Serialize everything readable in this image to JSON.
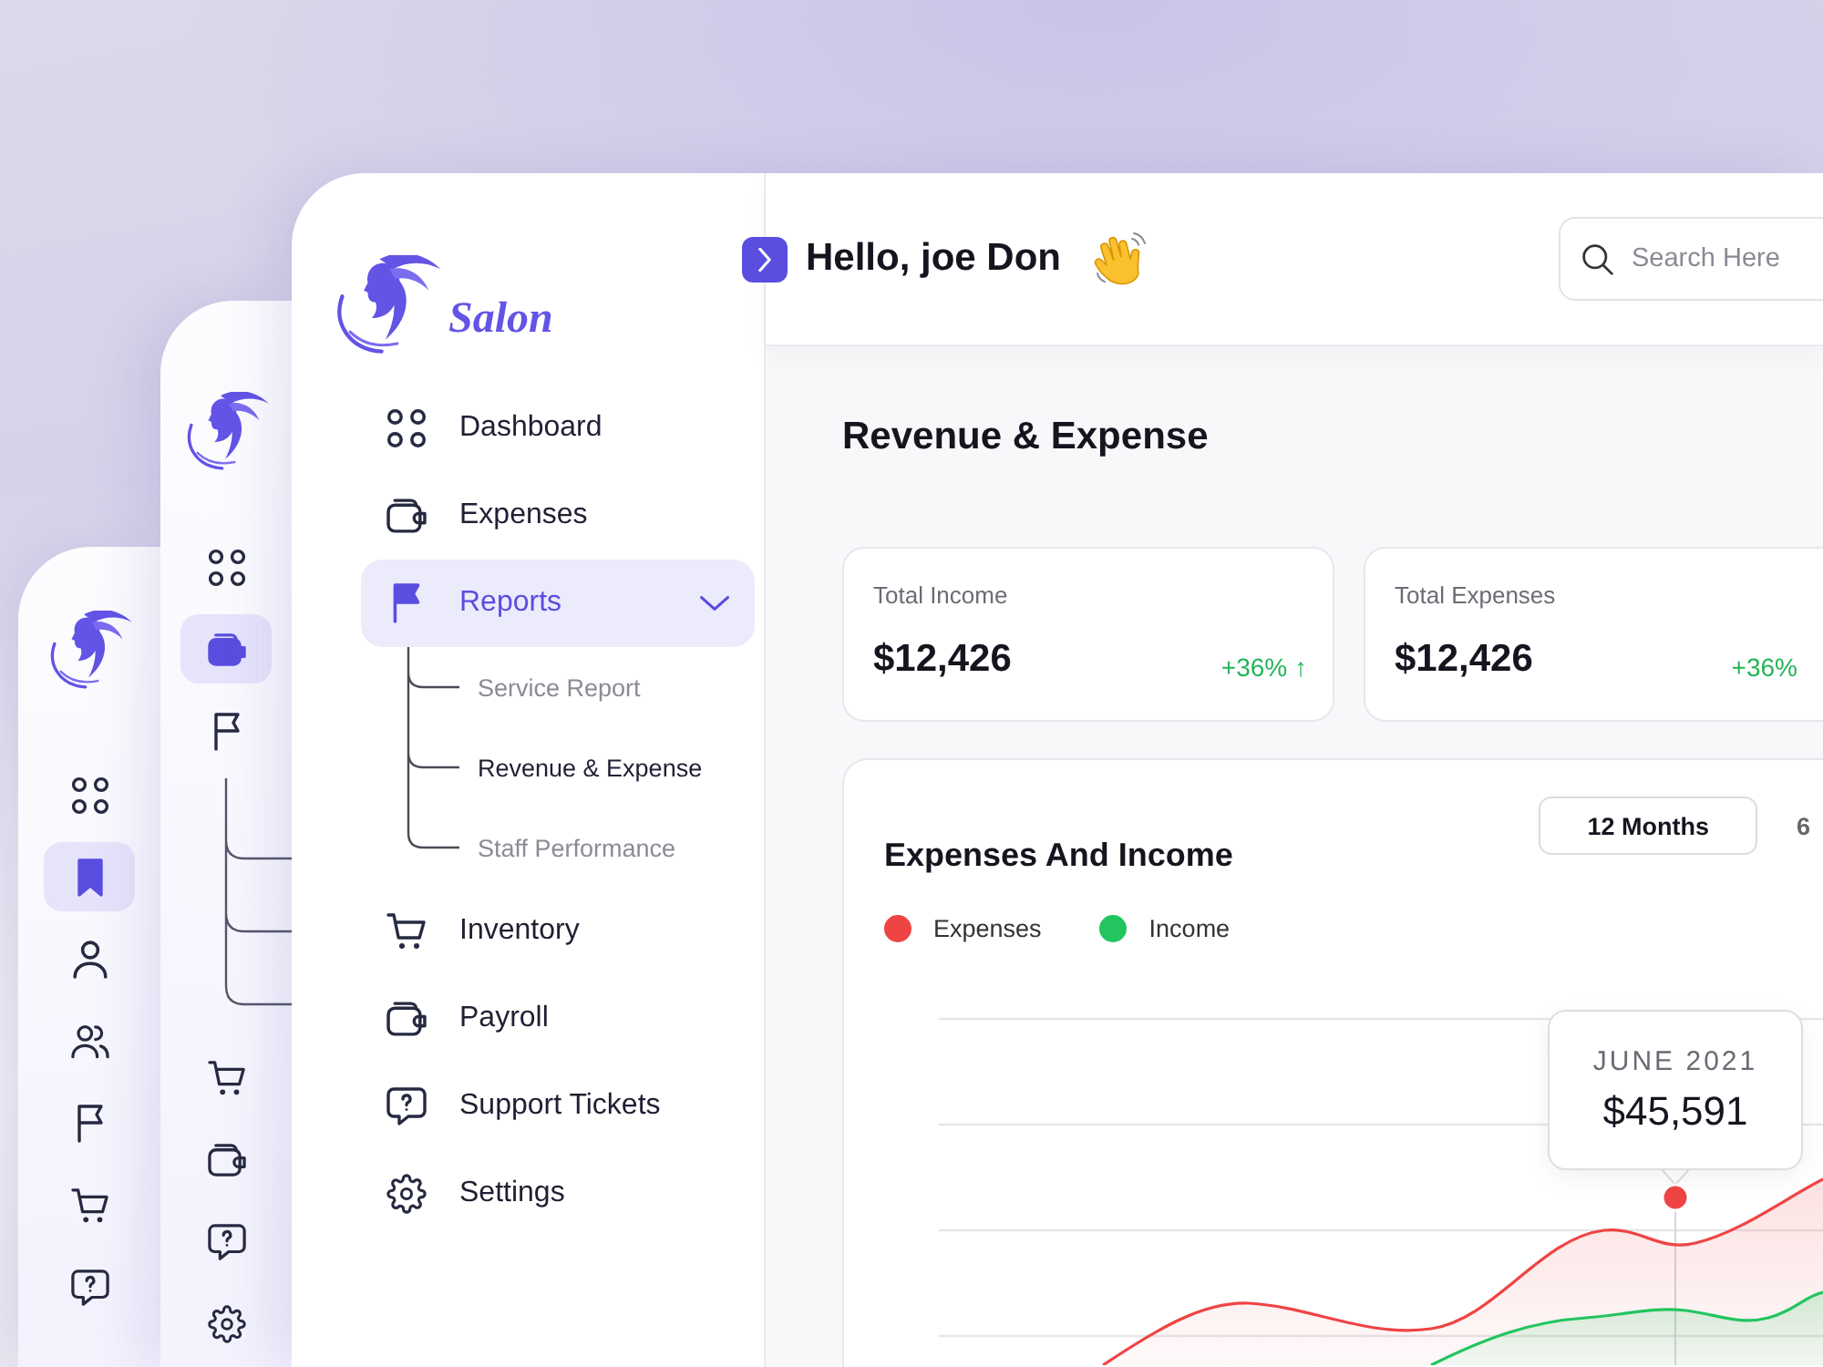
{
  "back_screens": [
    {
      "nav": [
        {
          "selected": false
        },
        {
          "selected": true
        },
        {
          "selected": false
        },
        {
          "selected": false
        },
        {
          "selected": false
        },
        {
          "selected": false
        },
        {
          "selected": false
        }
      ]
    },
    {
      "nav": [
        {
          "selected": false,
          "expanded": false
        },
        {
          "selected": true,
          "expanded": false
        },
        {
          "selected": false,
          "expanded": true
        },
        {
          "selected": false,
          "expanded": false
        },
        {
          "selected": false,
          "expanded": false
        },
        {
          "selected": false,
          "expanded": false
        },
        {
          "selected": false,
          "expanded": false
        }
      ]
    }
  ],
  "sidebar": {
    "brand": "Salon",
    "nav": [
      {
        "label": "Dashboard",
        "selected": false,
        "expanded": false
      },
      {
        "label": "Expenses",
        "selected": false,
        "expanded": false
      },
      {
        "label": "Reports",
        "selected": true,
        "expanded": true,
        "children": [
          {
            "label": "Service Report",
            "selected": false
          },
          {
            "label": "Revenue & Expense",
            "selected": true
          },
          {
            "label": "Staff Performance",
            "selected": false
          }
        ]
      },
      {
        "label": "Inventory",
        "selected": false,
        "expanded": false
      },
      {
        "label": "Payroll",
        "selected": false,
        "expanded": false
      },
      {
        "label": "Support Tickets",
        "selected": false,
        "expanded": false
      },
      {
        "label": "Settings",
        "selected": false,
        "expanded": false
      }
    ]
  },
  "header": {
    "greeting": "Hello, joe Don",
    "search": {
      "placeholder": "Search Here"
    }
  },
  "page": {
    "title": "Revenue & Expense",
    "stats": [
      {
        "label": "Total Income",
        "value": "$12,426",
        "change": "+36% ↑"
      },
      {
        "label": "Total Expenses",
        "value": "$12,426",
        "change": "+36%"
      }
    ],
    "chart_card": {
      "title": "Expenses And Income",
      "periods": [
        {
          "label": "12 Months",
          "selected": true
        },
        {
          "label": "6",
          "selected": false
        }
      ],
      "legend": [
        {
          "label": "Expenses",
          "color": "#ef4444"
        },
        {
          "label": "Income",
          "color": "#22c55e"
        }
      ],
      "tooltip": {
        "date": "JUNE 2021",
        "value": "$45,591"
      }
    }
  }
}
